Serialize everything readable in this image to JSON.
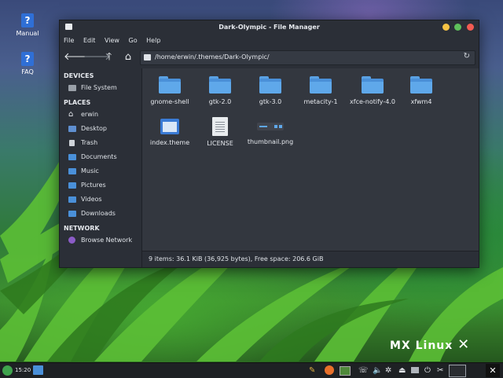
{
  "desktop": {
    "icons": [
      {
        "label": "Manual",
        "glyph": "?"
      },
      {
        "label": "FAQ",
        "glyph": "?"
      }
    ],
    "brand": "MX Linux"
  },
  "window": {
    "title": "Dark-Olympic - File Manager",
    "controls": {
      "minimize_color": "#f6c344",
      "maximize_color": "#5ec05b",
      "close_color": "#f25b52"
    },
    "menu": [
      "File",
      "Edit",
      "View",
      "Go",
      "Help"
    ],
    "path": "/home/erwin/.themes/Dark-Olympic/",
    "sidebar": {
      "devices_heading": "DEVICES",
      "devices": [
        {
          "label": "File System",
          "icon": "drive-icon"
        }
      ],
      "places_heading": "PLACES",
      "places": [
        {
          "label": "erwin",
          "icon": "home-icon"
        },
        {
          "label": "Desktop",
          "icon": "desktop-icon"
        },
        {
          "label": "Trash",
          "icon": "trash-icon"
        },
        {
          "label": "Documents",
          "icon": "folder-icon"
        },
        {
          "label": "Music",
          "icon": "music-folder-icon"
        },
        {
          "label": "Pictures",
          "icon": "pictures-folder-icon"
        },
        {
          "label": "Videos",
          "icon": "videos-folder-icon"
        },
        {
          "label": "Downloads",
          "icon": "downloads-folder-icon"
        }
      ],
      "network_heading": "NETWORK",
      "network": [
        {
          "label": "Browse Network",
          "icon": "network-icon"
        }
      ]
    },
    "files": [
      {
        "name": "gnome-shell",
        "type": "folder"
      },
      {
        "name": "gtk-2.0",
        "type": "folder"
      },
      {
        "name": "gtk-3.0",
        "type": "folder"
      },
      {
        "name": "metacity-1",
        "type": "folder"
      },
      {
        "name": "xfce-notify-4.0",
        "type": "folder"
      },
      {
        "name": "xfwm4",
        "type": "folder"
      },
      {
        "name": "index.theme",
        "type": "theme"
      },
      {
        "name": "LICENSE",
        "type": "document"
      },
      {
        "name": "thumbnail.png",
        "type": "image"
      }
    ],
    "status": "9 items: 36.1 KiB (36,925 bytes), Free space: 206.6 GiB"
  },
  "taskbar": {
    "clock": "15:20"
  },
  "colors": {
    "accent": "#4a90d9",
    "window_bg": "#2b2f37",
    "content_bg": "#33373f"
  }
}
